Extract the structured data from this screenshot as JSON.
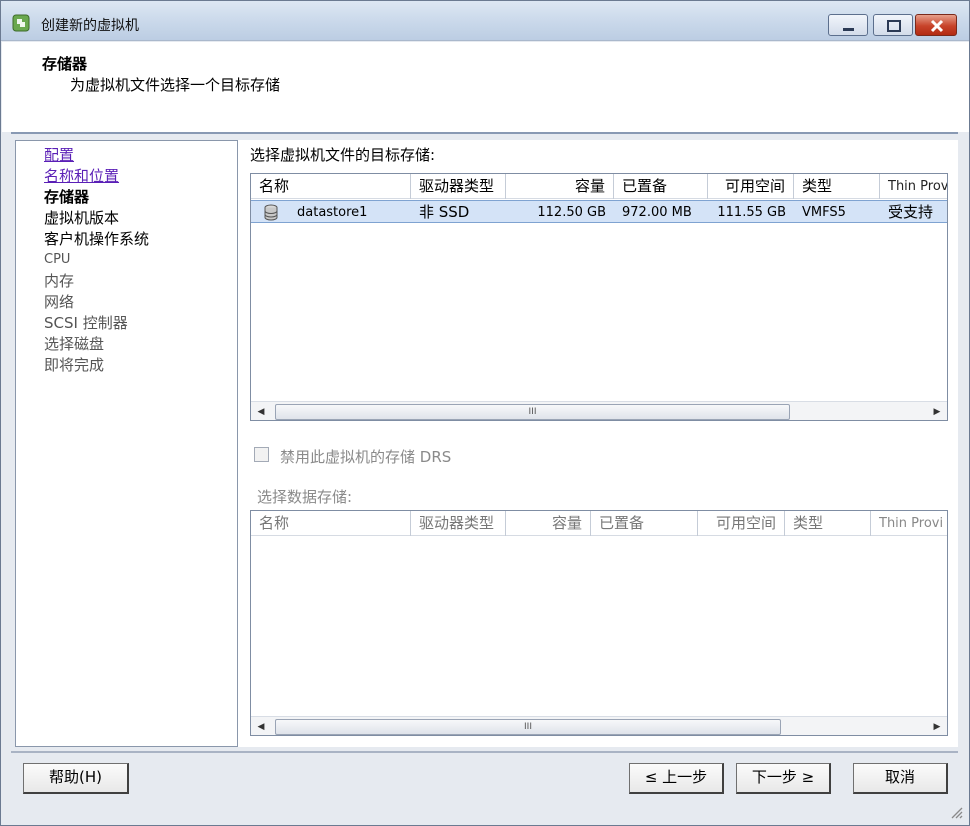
{
  "window": {
    "title": "创建新的虚拟机"
  },
  "header": {
    "title": "存储器",
    "subtitle": "为虚拟机文件选择一个目标存储"
  },
  "nav": {
    "items": [
      {
        "label": "配置",
        "state": "link"
      },
      {
        "label": "名称和位置",
        "state": "link"
      },
      {
        "label": "存储器",
        "state": "current"
      },
      {
        "label": "虚拟机版本",
        "state": "pending"
      },
      {
        "label": "客户机操作系统",
        "state": "pending"
      },
      {
        "label": "CPU",
        "state": "pending"
      },
      {
        "label": "内存",
        "state": "pending"
      },
      {
        "label": "网络",
        "state": "pending"
      },
      {
        "label": "SCSI 控制器",
        "state": "pending"
      },
      {
        "label": "选择磁盘",
        "state": "pending"
      },
      {
        "label": "即将完成",
        "state": "pending"
      }
    ]
  },
  "target_storage": {
    "label": "选择虚拟机文件的目标存储:",
    "columns": [
      "名称",
      "驱动器类型",
      "容量",
      "已置备",
      "可用空间",
      "类型",
      "Thin Prov"
    ],
    "rows": [
      {
        "icon": "datastore-icon",
        "name": "datastore1",
        "drive_type": "非 SSD",
        "capacity": "112.50 GB",
        "provisioned": "972.00 MB",
        "free": "111.55 GB",
        "type": "VMFS5",
        "thin": "受支持",
        "selected": true
      }
    ]
  },
  "drs": {
    "label": "禁用此虚拟机的存储 DRS",
    "checked": false,
    "enabled": false
  },
  "data_storage": {
    "label": "选择数据存储:",
    "columns": [
      "名称",
      "驱动器类型",
      "容量",
      "已置备",
      "可用空间",
      "类型",
      "Thin Provi"
    ],
    "rows": []
  },
  "scroll_thumb_grip": "III",
  "buttons": {
    "help": "帮助(H)",
    "prev": "≤ 上一步",
    "next": "下一步 ≥",
    "cancel": "取消"
  }
}
